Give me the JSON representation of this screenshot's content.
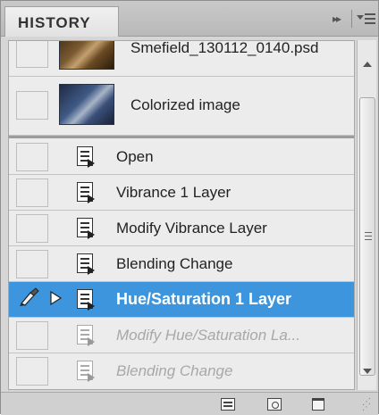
{
  "panel": {
    "tab_title": "HISTORY",
    "collapse_glyph": "▸▸",
    "menu_icon": "panel-menu-icon"
  },
  "snapshots": [
    {
      "label": "Smefield_130112_0140.psd",
      "thumb": "snapshot-thumbnail-photo"
    },
    {
      "label": "Colorized image",
      "thumb": "snapshot-thumbnail-photo"
    }
  ],
  "states": [
    {
      "label": "Open",
      "status": "active"
    },
    {
      "label": "Vibrance 1 Layer",
      "status": "active"
    },
    {
      "label": "Modify Vibrance Layer",
      "status": "active"
    },
    {
      "label": "Blending Change",
      "status": "active"
    },
    {
      "label": "Hue/Saturation 1 Layer",
      "status": "selected",
      "history_brush_source": true
    },
    {
      "label": "Modify Hue/Saturation La...",
      "status": "undone"
    },
    {
      "label": "Blending Change",
      "status": "undone"
    }
  ],
  "bottom_bar": {
    "buttons": [
      "new-document-from-state-icon",
      "new-snapshot-icon",
      "delete-state-icon"
    ]
  },
  "colors": {
    "selection": "#3d95dd",
    "panel_bg": "#d6d6d6",
    "list_bg": "#ececec",
    "undone_text": "#a8a8a8"
  }
}
